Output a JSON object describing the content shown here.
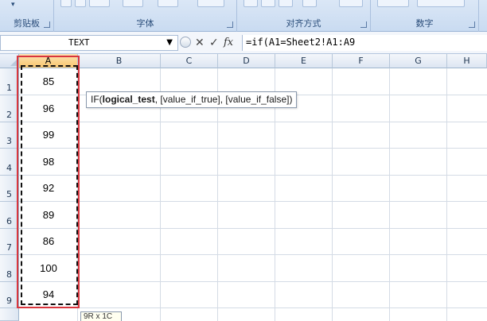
{
  "ribbon": {
    "groups": [
      {
        "label": "剪贴板"
      },
      {
        "label": "字体"
      },
      {
        "label": "对齐方式"
      },
      {
        "label": "数字"
      }
    ]
  },
  "formula_bar": {
    "name_box": "TEXT",
    "formula": "=if(A1=Sheet2!A1:A9"
  },
  "columns": [
    "A",
    "B",
    "C",
    "D",
    "E",
    "F",
    "G",
    "H"
  ],
  "rows": [
    "1",
    "2",
    "3",
    "4",
    "5",
    "6",
    "7",
    "8",
    "9"
  ],
  "cells_a": [
    "85",
    "96",
    "99",
    "98",
    "92",
    "89",
    "86",
    "100",
    "94"
  ],
  "tooltip": {
    "func": "IF(",
    "arg1": "logical_test",
    "rest": ", [value_if_true], [value_if_false])"
  },
  "selection_size": "9R x 1C",
  "colors": {
    "selection_frame": "#d9363e",
    "active_header": "#f8c66f"
  }
}
